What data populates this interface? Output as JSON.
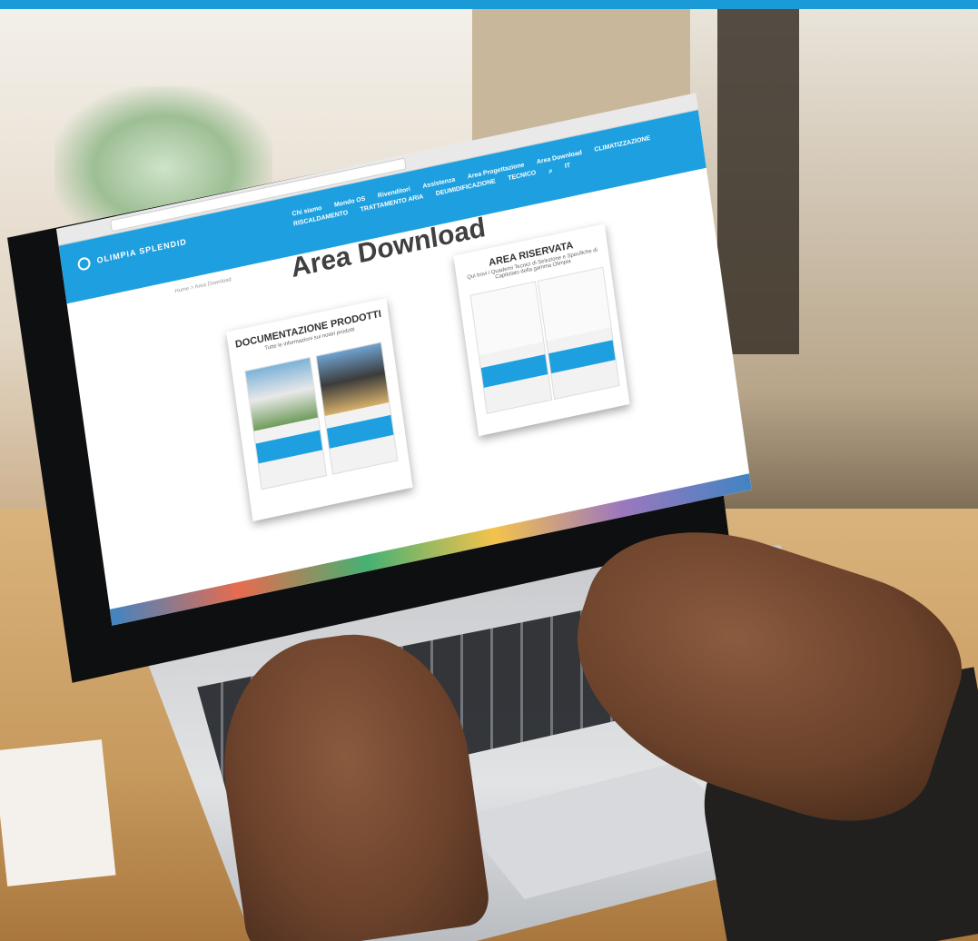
{
  "header": {
    "logo_text": "OLIMPIA SPLENDID",
    "nav_row1": [
      "Chi siamo",
      "Mondo OS",
      "Rivenditori",
      "Assistenza",
      "Area Progettazione",
      "Area Download"
    ],
    "nav_row2": [
      "CLIMATIZZAZIONE",
      "RISCALDAMENTO",
      "TRATTAMENTO ARIA",
      "DEUMIDIFICAZIONE",
      "TECNICO",
      "IT"
    ]
  },
  "page": {
    "breadcrumb": "Home > Area Download",
    "title": "Area Download"
  },
  "cards": {
    "docs": {
      "title": "DOCUMENTAZIONE PRODOTTI",
      "subtitle": "Tutte le informazioni sui nostri prodotti"
    },
    "reserved": {
      "title": "AREA RISERVATA",
      "subtitle": "Qui trovi i Quaderni Tecnici di Selezione e Specifiche di Capitolato della gamma Olimpia"
    }
  },
  "colors": {
    "top_band": "#1a9ad6",
    "site_header": "#1ea0e0",
    "title_text": "#404040"
  },
  "icons": [
    "search-icon",
    "logo-mark-icon"
  ]
}
